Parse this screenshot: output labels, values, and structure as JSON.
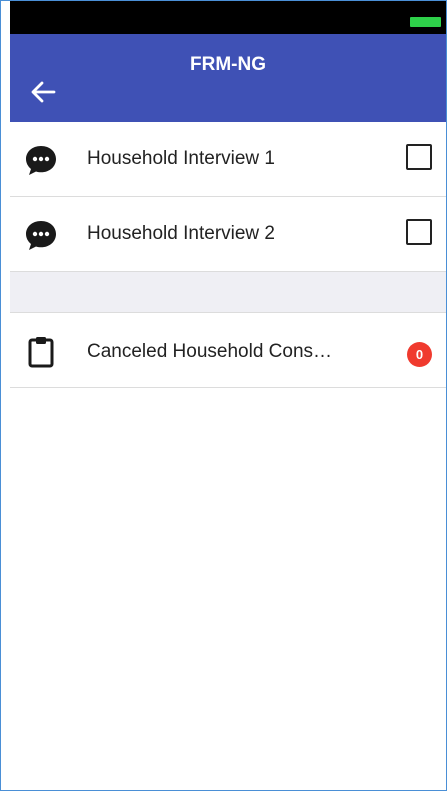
{
  "header": {
    "title": "FRM-NG"
  },
  "items": [
    {
      "label": "Household Interview 1"
    },
    {
      "label": "Household Interview 2"
    }
  ],
  "canceled": {
    "label": "Canceled Household Cons…",
    "count": "0"
  },
  "colors": {
    "app_bar": "#3f51b5",
    "badge": "#f03a2e",
    "battery": "#2ed04a"
  }
}
